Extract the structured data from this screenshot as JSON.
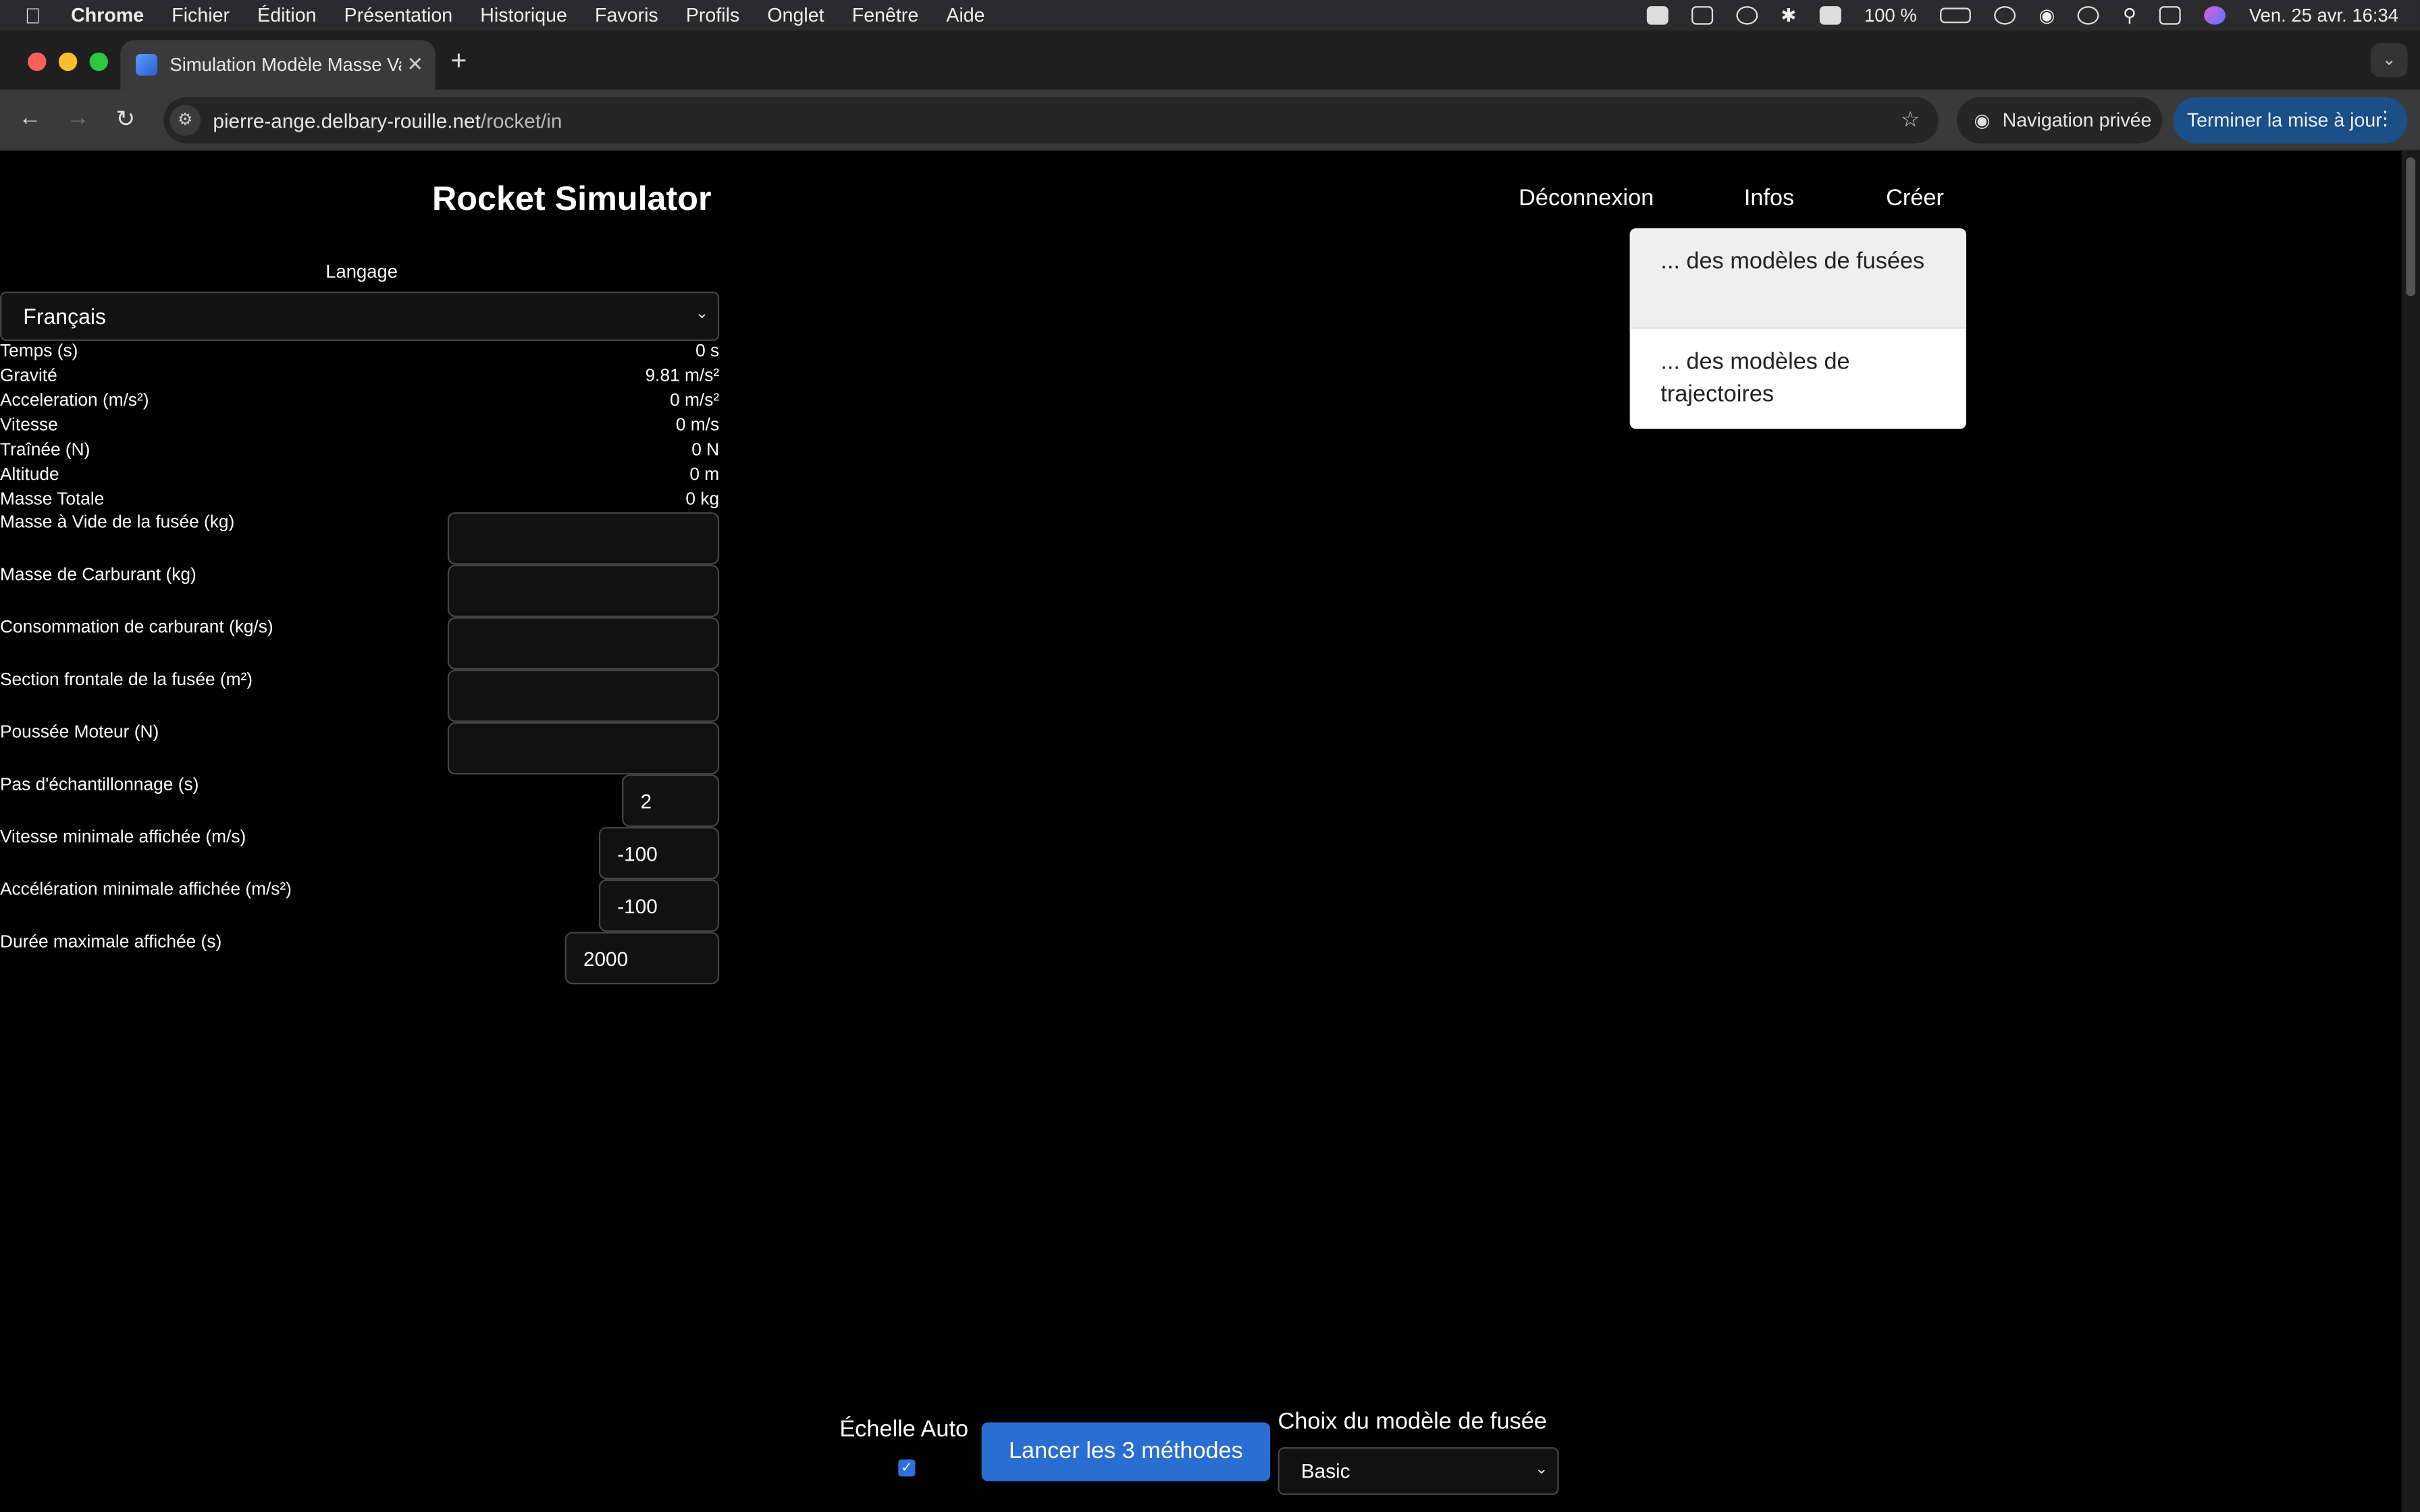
{
  "menubar": {
    "app": "Chrome",
    "items": [
      "Fichier",
      "Édition",
      "Présentation",
      "Historique",
      "Favoris",
      "Profils",
      "Onglet",
      "Fenêtre",
      "Aide"
    ],
    "battery": "100 %",
    "datetime": "Ven. 25 avr.  16:34"
  },
  "browser": {
    "tab_title": "Simulation Modèle Masse Variable",
    "url_host": "pierre-ange.delbary-rouille.net",
    "url_path": "/rocket/in",
    "private_label": "Navigation privée",
    "update_label": "Terminer la mise à jour"
  },
  "app": {
    "title": "Rocket Simulator",
    "nav": {
      "logout": "Déconnexion",
      "infos": "Infos",
      "create": "Créer"
    },
    "create_menu": [
      "... des modèles de fusées",
      "... des modèles de trajectoires"
    ],
    "language_label": "Langage",
    "language_value": "Français",
    "stats": [
      {
        "label": "Temps (s)",
        "value": "0 s"
      },
      {
        "label": "Gravité",
        "value": "9.81 m/s²"
      },
      {
        "label": "Acceleration (m/s²)",
        "value": "0 m/s²"
      },
      {
        "label": "Vitesse",
        "value": "0 m/s"
      },
      {
        "label": "Traînée (N)",
        "value": "0 N"
      },
      {
        "label": "Altitude",
        "value": "0 m"
      },
      {
        "label": "Masse Totale",
        "value": "0 kg"
      }
    ],
    "fields": [
      {
        "label": "Masse à Vide de la fusée (kg)",
        "value": ""
      },
      {
        "label": "Masse de Carburant (kg)",
        "value": ""
      },
      {
        "label": "Consommation de carburant (kg/s)",
        "value": ""
      },
      {
        "label": "Section frontale de la fusée (m²)",
        "value": ""
      },
      {
        "label": "Poussée Moteur (N)",
        "value": ""
      },
      {
        "label": "Pas d'échantillonnage (s)",
        "value": "2"
      },
      {
        "label": "Vitesse minimale affichée (m/s)",
        "value": "-100"
      },
      {
        "label": "Accélération minimale affichée (m/s²)",
        "value": "-100"
      },
      {
        "label": "Durée maximale affichée (s)",
        "value": "2000"
      }
    ],
    "auto_scale_label": "Échelle Auto",
    "auto_scale_checked": true,
    "run_button": "Lancer les 3 méthodes",
    "model_label": "Choix du modèle de fusée",
    "model_value": "Basic"
  },
  "colors": {
    "accent": "#2a6ed3",
    "page_bg": "#000000",
    "update_button": "#1b4f86"
  }
}
